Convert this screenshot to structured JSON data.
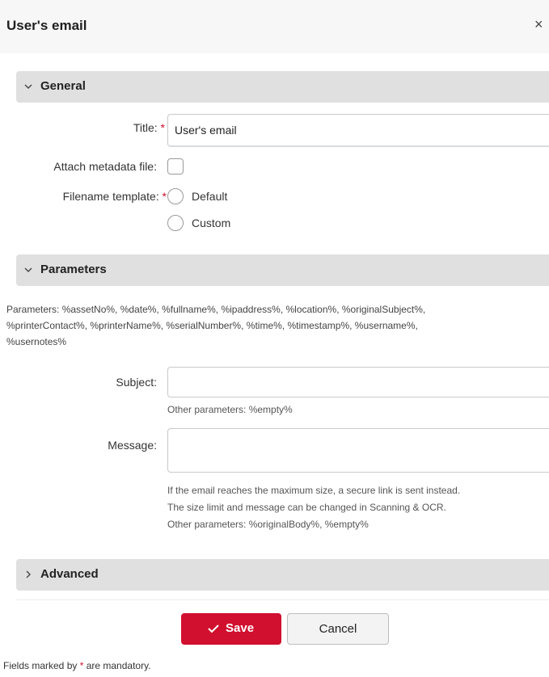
{
  "dialog": {
    "title": "User's email",
    "close_glyph": "×"
  },
  "sections": {
    "general": {
      "label": "General",
      "expanded": true
    },
    "parameters": {
      "label": "Parameters",
      "expanded": true
    },
    "advanced": {
      "label": "Advanced",
      "expanded": false
    }
  },
  "general": {
    "title_label": "Title:",
    "title_value": "User's email",
    "attach_label": "Attach metadata file:",
    "attach_checked": false,
    "filename_label": "Filename template:",
    "filename_options": [
      "Default",
      "Custom"
    ],
    "required_mark": "*"
  },
  "parameters": {
    "lines": [
      "Parameters: %assetNo%, %date%, %fullname%, %ipaddress%, %location%, %originalSubject%,",
      "%printerContact%, %printerName%, %serialNumber%, %time%, %timestamp%, %username%,",
      "%usernotes%"
    ],
    "subject_label": "Subject:",
    "subject_value": "",
    "subject_hint": "Other parameters: %empty%",
    "message_label": "Message:",
    "message_value": "",
    "message_hints": [
      "If the email reaches the maximum size, a secure link is sent instead.",
      "The size limit and message can be changed in Scanning & OCR.",
      "Other parameters: %originalBody%, %empty%"
    ]
  },
  "actions": {
    "save_label": "Save",
    "cancel_label": "Cancel"
  },
  "footnote": {
    "prefix": "Fields marked by ",
    "mark": "*",
    "suffix": " are mandatory."
  },
  "colors": {
    "accent": "#d0102e",
    "section_bg": "#e0e0e0",
    "header_bg": "#f7f7f7"
  },
  "icons": {
    "close": "close-icon",
    "expanded": "chevron-down-icon",
    "collapsed": "chevron-right-icon",
    "save": "check-icon"
  }
}
